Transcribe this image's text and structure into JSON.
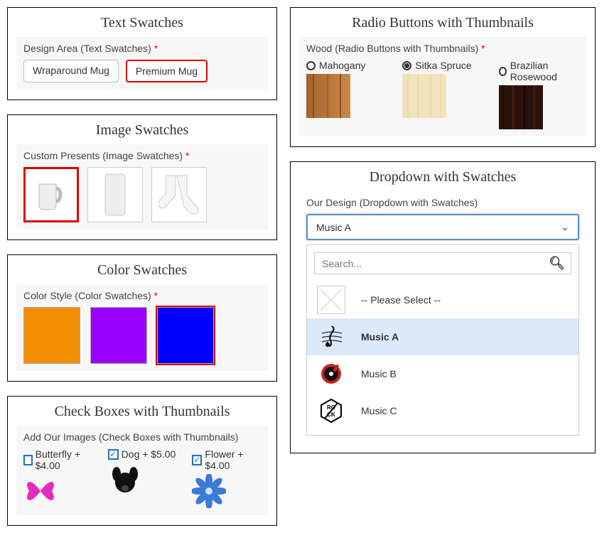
{
  "text_swatches": {
    "title": "Text Swatches",
    "label": "Design Area (Text Swatches)",
    "required": "*",
    "options": [
      {
        "label": "Wraparound Mug",
        "selected": false
      },
      {
        "label": "Premium Mug",
        "selected": true
      }
    ]
  },
  "image_swatches": {
    "title": "Image Swatches",
    "label": "Custom Presents (Image Swatches)",
    "required": "*",
    "options": [
      {
        "icon": "mug",
        "selected": true
      },
      {
        "icon": "phonecase",
        "selected": false
      },
      {
        "icon": "socks",
        "selected": false
      }
    ]
  },
  "color_swatches": {
    "title": "Color Swatches",
    "label": "Color Style (Color Swatches)",
    "required": "*",
    "options": [
      {
        "color": "#f28c00",
        "selected": false
      },
      {
        "color": "#9a00ff",
        "selected": false
      },
      {
        "color": "#0000ff",
        "selected": true
      }
    ]
  },
  "check_thumbnails": {
    "title": "Check Boxes with Thumbnails",
    "label": "Add Our Images (Check Boxes with Thumbnails)",
    "options": [
      {
        "label": "Butterfly + $4.00",
        "checked": false,
        "icon": "butterfly",
        "color": "#e52cc1"
      },
      {
        "label": "Dog + $5.00",
        "checked": true,
        "icon": "dog",
        "color": "#111"
      },
      {
        "label": "Flower + $4.00",
        "checked": true,
        "icon": "flower",
        "color": "#3a7bd5"
      }
    ]
  },
  "radio_thumbnails": {
    "title": "Radio Buttons with Thumbnails",
    "label": "Wood (Radio Buttons with Thumbnails)",
    "required": "*",
    "options": [
      {
        "label": "Mahogany",
        "checked": false,
        "colors": [
          "#b97a3a",
          "#a56428"
        ]
      },
      {
        "label": "Sitka Spruce",
        "checked": true,
        "colors": [
          "#f3e3bd",
          "#ead49f"
        ]
      },
      {
        "label": "Brazilian Rosewood",
        "checked": false,
        "colors": [
          "#2a120a",
          "#3d1c0d"
        ]
      }
    ]
  },
  "dropdown": {
    "title": "Dropdown with Swatches",
    "label": "Our Design (Dropdown with Swatches)",
    "selected_value": "Music A",
    "search_placeholder": "Search...",
    "options": [
      {
        "label": "-- Please Select --",
        "icon": "none",
        "selected": false
      },
      {
        "label": "Music A",
        "icon": "clef",
        "selected": true
      },
      {
        "label": "Music B",
        "icon": "disc",
        "selected": false
      },
      {
        "label": "Music C",
        "icon": "rock",
        "selected": false
      }
    ]
  }
}
